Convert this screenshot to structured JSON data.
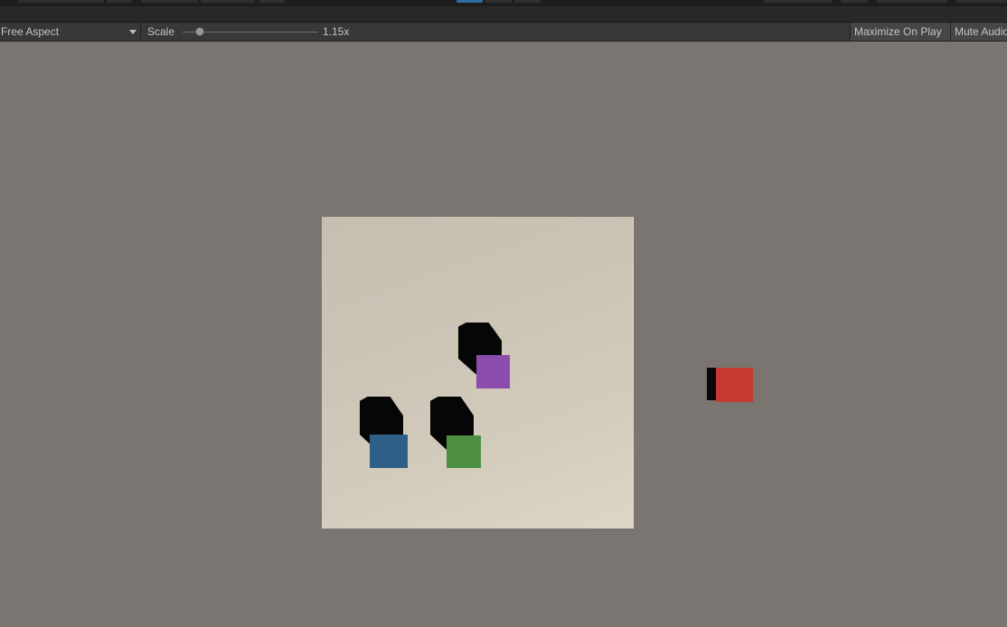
{
  "toolbar": {
    "aspect_value": "Free Aspect",
    "scale_label": "Scale",
    "scale_value": "1.15x",
    "scale_fraction": 0.1,
    "maximize_label": "Maximize On Play",
    "mute_label": "Mute Audio"
  },
  "scene": {
    "cubes": [
      {
        "name": "purple-cube",
        "color": "#8b4cae"
      },
      {
        "name": "blue-cube",
        "color": "#2e5f88"
      },
      {
        "name": "green-cube",
        "color": "#4d9041"
      },
      {
        "name": "red-cube",
        "color": "#c43a2e"
      }
    ]
  },
  "colors": {
    "viewport_bg": "#7a7570",
    "toolbar_bg": "#383838",
    "accent": "#2f6ea5"
  }
}
